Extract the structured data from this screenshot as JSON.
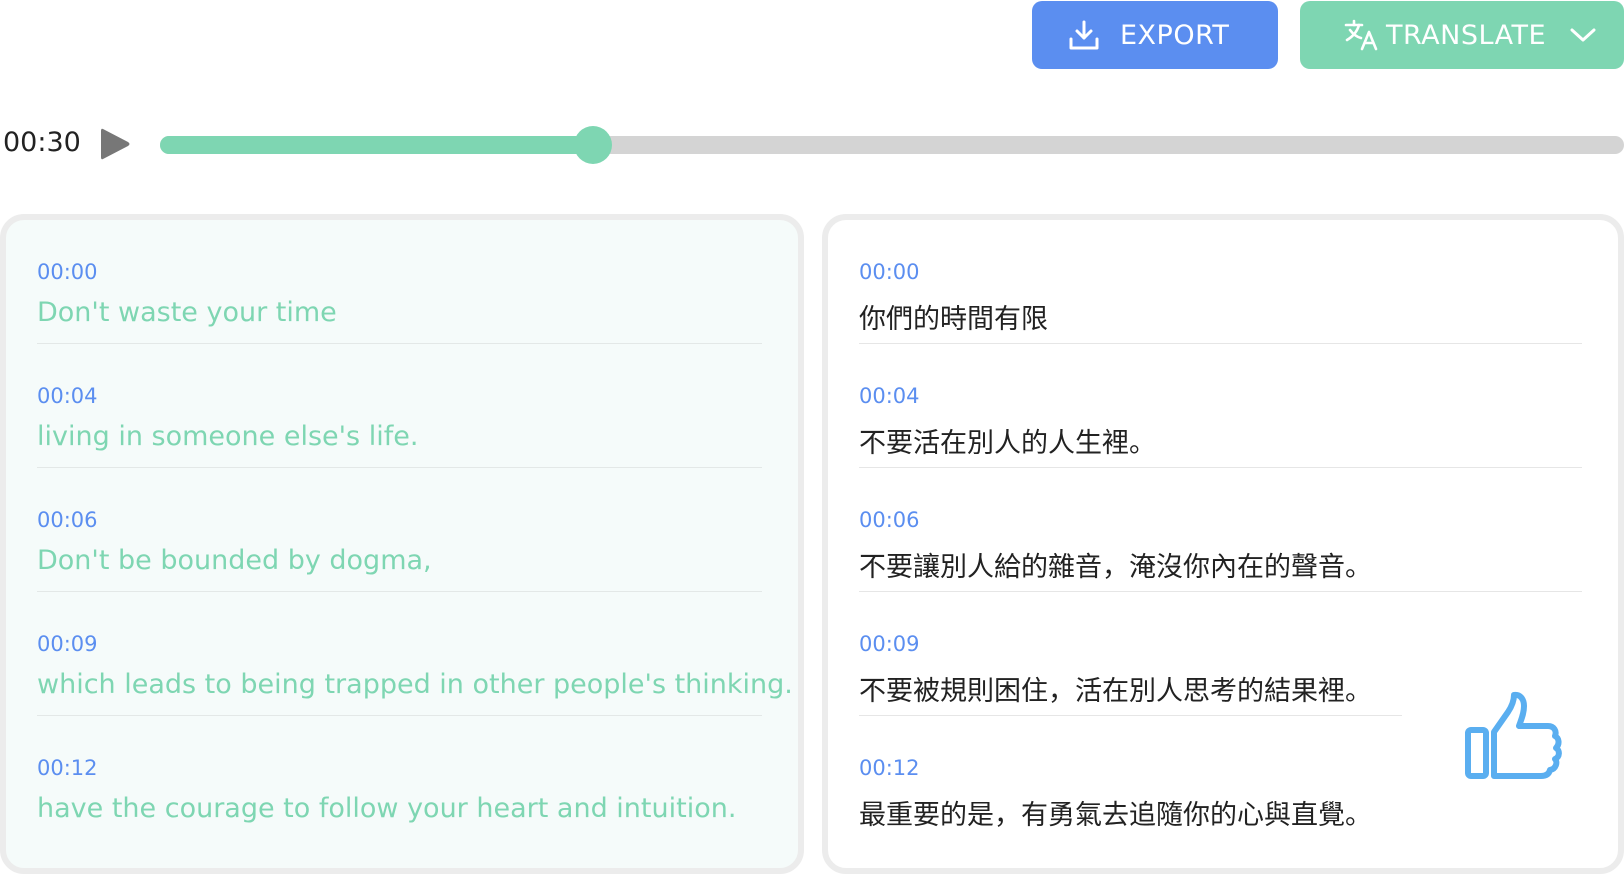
{
  "toolbar": {
    "export_label": "EXPORT",
    "translate_label": "TRANSLATE",
    "export_color": "#5b8ef0",
    "translate_color": "#7ed6b2"
  },
  "player": {
    "current_time": "00:30",
    "progress_percent": 29.6
  },
  "transcript": [
    {
      "time": "00:00",
      "text": "Don't waste your time"
    },
    {
      "time": "00:04",
      "text": "living in someone else's life."
    },
    {
      "time": "00:06",
      "text": "Don't be bounded by dogma,"
    },
    {
      "time": "00:09",
      "text": "which leads to being trapped in other people's thinking."
    },
    {
      "time": "00:12",
      "text": "have the courage to follow your heart and intuition."
    }
  ],
  "translation": [
    {
      "time": "00:00",
      "text": "你們的時間有限"
    },
    {
      "time": "00:04",
      "text": "不要活在別人的人生裡。"
    },
    {
      "time": "00:06",
      "text": "不要讓別人給的雜音，淹沒你內在的聲音。"
    },
    {
      "time": "00:09",
      "text": "不要被規則困住，活在別人思考的結果裡。"
    },
    {
      "time": "00:12",
      "text": "最重要的是，有勇氣去追隨你的心與直覺。"
    }
  ],
  "icons": {
    "export": "download-icon",
    "translate": "translate-icon",
    "dropdown": "chevron-down-icon",
    "play": "play-icon",
    "feedback": "thumbs-up-icon"
  }
}
